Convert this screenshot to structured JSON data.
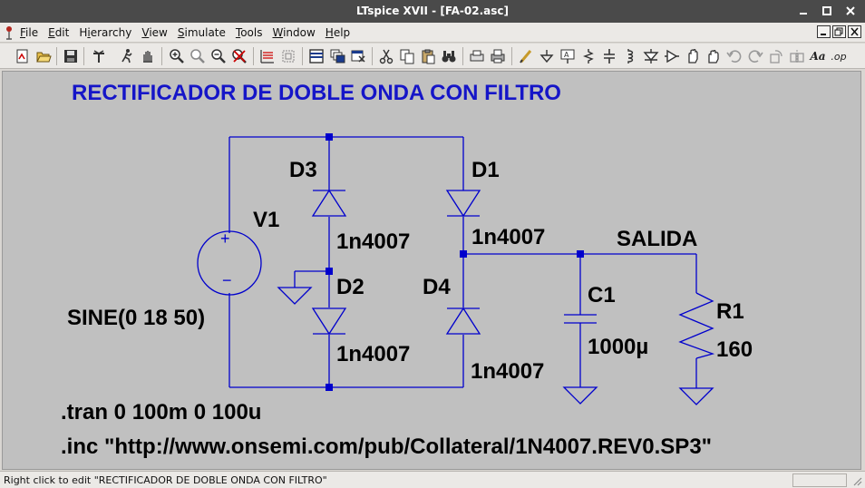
{
  "window": {
    "title": "LTspice XVII - [FA-02.asc]",
    "controls": [
      "minimize-icon",
      "restore-icon",
      "close-icon"
    ]
  },
  "menubar": {
    "items": [
      {
        "label": "File",
        "accel": "F"
      },
      {
        "label": "Edit",
        "accel": "E"
      },
      {
        "label": "Hierarchy",
        "accel": "i"
      },
      {
        "label": "View",
        "accel": "V"
      },
      {
        "label": "Simulate",
        "accel": "S"
      },
      {
        "label": "Tools",
        "accel": "T"
      },
      {
        "label": "Window",
        "accel": "W"
      },
      {
        "label": "Help",
        "accel": "H"
      }
    ]
  },
  "toolbar": {
    "buttons": [
      "new-schematic-icon",
      "open-icon",
      "save-icon",
      "control-panel-icon",
      "run-icon",
      "halt-icon",
      "zoom-in-icon",
      "pan-icon",
      "zoom-out-icon",
      "zoom-fit-icon",
      "autorange-icon",
      "mark-unused-icon",
      "tile-horizontal-icon",
      "cascade-icon",
      "close-window-icon",
      "cut-icon",
      "copy-icon",
      "paste-icon",
      "find-icon",
      "print-setup-icon",
      "print-icon",
      "draw-wire-icon",
      "ground-icon",
      "label-net-icon",
      "resistor-icon",
      "capacitor-icon",
      "inductor-icon",
      "diode-icon",
      "component-icon",
      "move-icon",
      "drag-icon",
      "undo-icon",
      "redo-icon",
      "rotate-icon",
      "mirror-icon",
      "text-icon",
      "spice-directive-icon"
    ],
    "text_icon_label": "Aa",
    "directive_icon_label": ".op"
  },
  "schematic": {
    "title": "RECTIFICADOR DE DOBLE ONDA CON FILTRO",
    "title_color": "#1515c8",
    "wire_color": "#0000cc",
    "background": "#c0c0c0",
    "components": {
      "V1": {
        "name": "V1",
        "value": "SINE(0 18 50)"
      },
      "D1": {
        "name": "D1",
        "value": "1n4007"
      },
      "D2": {
        "name": "D2",
        "value": "1n4007"
      },
      "D3": {
        "name": "D3",
        "value": "1n4007"
      },
      "D4": {
        "name": "D4",
        "value": "1n4007"
      },
      "C1": {
        "name": "C1",
        "value": "1000µ"
      },
      "R1": {
        "name": "R1",
        "value": "160"
      }
    },
    "net_label": "SALIDA",
    "source_plus": "+",
    "source_minus": "−",
    "directives": [
      ".tran 0 100m 0 100u",
      ".inc \"http://www.onsemi.com/pub/Collateral/1N4007.REV0.SP3\""
    ]
  },
  "statusbar": {
    "message": "Right click to edit \"RECTIFICADOR DE DOBLE ONDA CON FILTRO\""
  }
}
